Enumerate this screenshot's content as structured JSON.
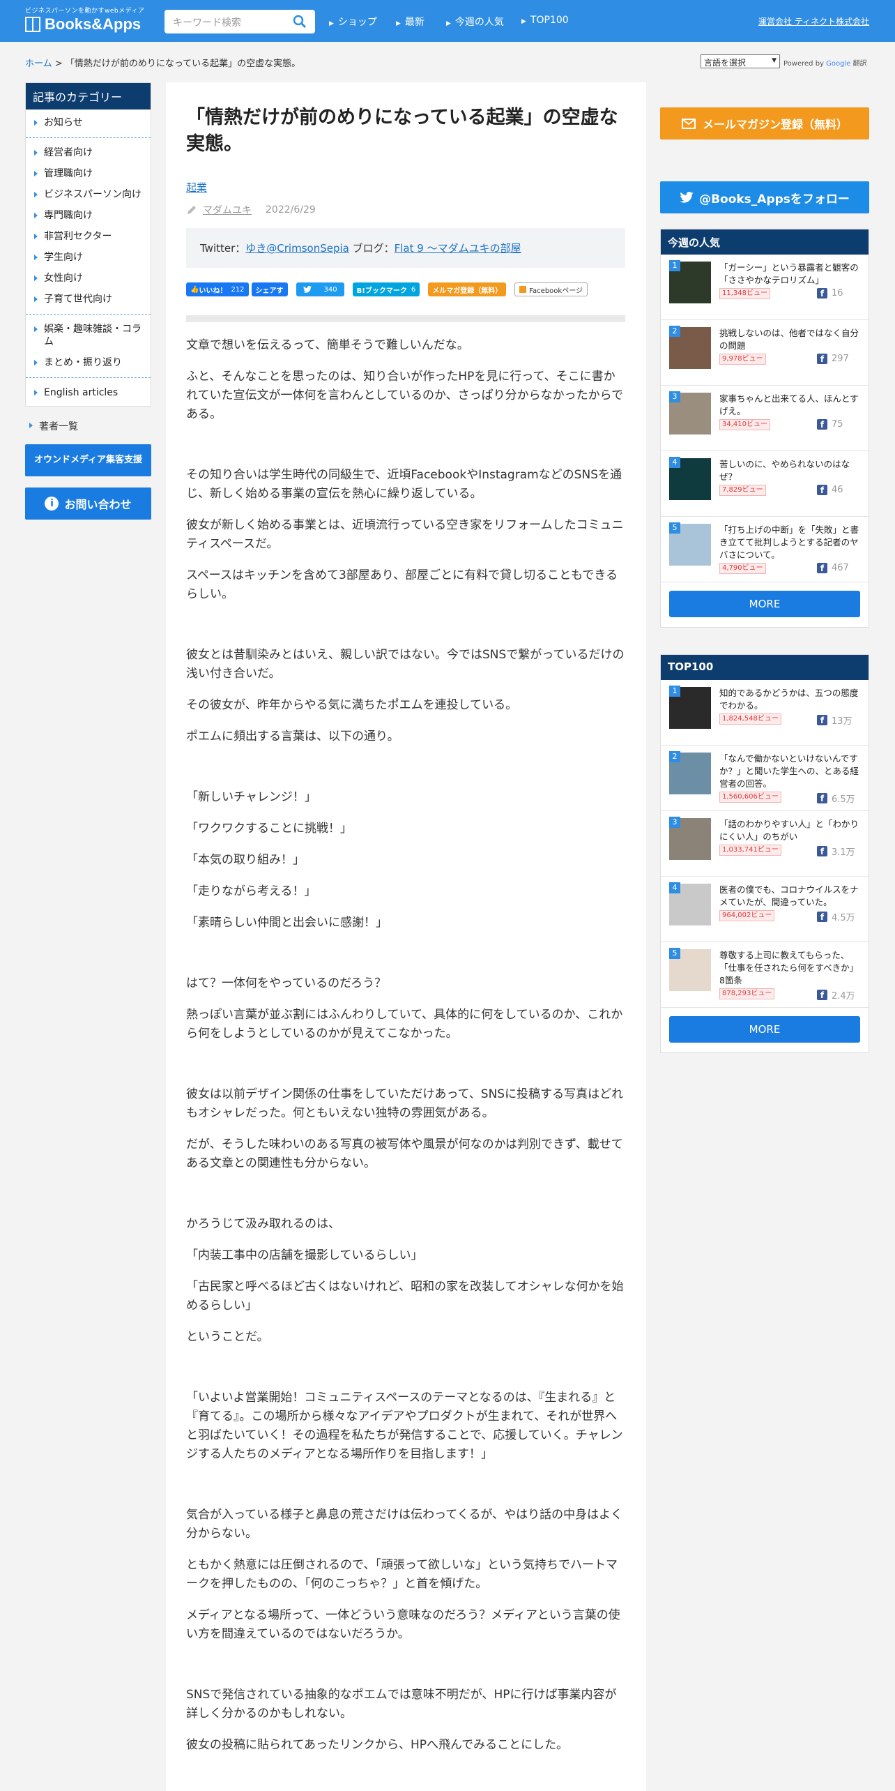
{
  "header": {
    "tagline": "ビジネスパーソンを動かすwebメディア",
    "logo": "Books&Apps",
    "search_placeholder": "キーワード検索",
    "nav": [
      "ショップ",
      "最新",
      "今週の人気",
      "TOP100"
    ],
    "company": "運営会社 ティネクト株式会社"
  },
  "breadcrumb": {
    "home": "ホーム",
    "sep": ">",
    "current": "「情熱だけが前のめりになっている起業」の空虚な実態。"
  },
  "translate": {
    "select": "言語を選択",
    "powered": "Powered by",
    "google": "Google",
    "label": "翻訳"
  },
  "left": {
    "cat_title": "記事のカテゴリー",
    "group1": [
      "お知らせ"
    ],
    "group2": [
      "経営者向け",
      "管理職向け",
      "ビジネスパーソン向け",
      "専門職向け",
      "非営利セクター",
      "学生向け",
      "女性向け",
      "子育て世代向け"
    ],
    "group3": [
      "娯楽・趣味雑談・コラム",
      "まとめ・振り返り"
    ],
    "group4": [
      "English articles"
    ],
    "authors": "著者一覧",
    "owned_media": "オウンドメディア集客支援",
    "contact": "お問い合わせ"
  },
  "article": {
    "title": "「情熱だけが前のめりになっている起業」の空虚な実態。",
    "category": "起業",
    "author": "マダムユキ",
    "date": "2022/6/29",
    "tw_prefix": "Twitter：",
    "tw_link": "ゆき@CrimsonSepia",
    "blog_prefix": " ブログ：",
    "blog_link": "Flat 9 〜マダムユキの部屋",
    "share": {
      "like": "いいね！",
      "like_count": "212",
      "share": "シェアす",
      "tweet_count": "340",
      "hatena": "B!ブックマーク",
      "hatena_count": "6",
      "mail": "メルマガ登録（無料）",
      "fbpage": "Facebookページ"
    },
    "p": [
      "文章で想いを伝えるって、簡単そうで難しいんだな。",
      "ふと、そんなことを思ったのは、知り合いが作ったHPを見に行って、そこに書かれていた宣伝文が一体何を言わんとしているのか、さっぱり分からなかったからである。",
      "その知り合いは学生時代の同級生で、近頃FacebookやInstagramなどのSNSを通じ、新しく始める事業の宣伝を熱心に繰り返している。",
      "彼女が新しく始める事業とは、近頃流行っている空き家をリフォームしたコミュニティスペースだ。",
      "スペースはキッチンを含めて3部屋あり、部屋ごとに有料で貸し切ることもできるらしい。",
      "彼女とは昔馴染みとはいえ、親しい訳ではない。今ではSNSで繋がっているだけの浅い付き合いだ。",
      "その彼女が、昨年からやる気に満ちたポエムを連投している。",
      "ポエムに頻出する言葉は、以下の通り。",
      "「新しいチャレンジ！」",
      "「ワクワクすることに挑戦！」",
      "「本気の取り組み！」",
      "「走りながら考える！」",
      "「素晴らしい仲間と出会いに感謝！」",
      "はて？一体何をやっているのだろう？",
      "熱っぽい言葉が並ぶ割にはふんわりしていて、具体的に何をしているのか、これから何をしようとしているのかが見えてこなかった。",
      "彼女は以前デザイン関係の仕事をしていただけあって、SNSに投稿する写真はどれもオシャレだった。何ともいえない独特の雰囲気がある。",
      "だが、そうした味わいのある写真の被写体や風景が何なのかは判別できず、載せてある文章との関連性も分からない。",
      "かろうじて汲み取れるのは、",
      "「内装工事中の店舗を撮影しているらしい」",
      "「古民家と呼べるほど古くはないけれど、昭和の家を改装してオシャレな何かを始めるらしい」",
      "ということだ。",
      "「いよいよ営業開始！コミュニティスペースのテーマとなるのは、『生まれる』と『育てる』。この場所から様々なアイデアやプロダクトが生まれて、それが世界へと羽ばたいていく！その過程を私たちが発信することで、応援していく。チャレンジする人たちのメディアとなる場所作りを目指します！」",
      "気合が入っている様子と鼻息の荒さだけは伝わってくるが、やはり話の中身はよく分からない。",
      "ともかく熱意には圧倒されるので、「頑張って欲しいな」という気持ちでハートマークを押したものの、「何のこっちゃ？」と首を傾げた。",
      "メディアとなる場所って、一体どういう意味なのだろう？メディアという言葉の使い方を間違えているのではないだろうか。",
      "SNSで発信されている抽象的なポエムでは意味不明だが、HPに行けば事業内容が詳しく分かるのかもしれない。",
      "彼女の投稿に貼られてあったリンクから、HPへ飛んでみることにした。"
    ]
  },
  "right": {
    "mail_btn": "メールマガジン登録（無料）",
    "tw_btn": "@Books_Appsをフォロー",
    "weekly_title": "今週の人気",
    "weekly": [
      {
        "n": "1",
        "title": "「ガーシー」という暴露者と観客の「ささやかなテロリズム」",
        "views": "11,348ビュー",
        "fb": "16"
      },
      {
        "n": "2",
        "title": "挑戦しないのは、他者ではなく自分の問題",
        "views": "9,978ビュー",
        "fb": "297"
      },
      {
        "n": "3",
        "title": "家事ちゃんと出来てる人、ほんとすげえ。",
        "views": "34,410ビュー",
        "fb": "75"
      },
      {
        "n": "4",
        "title": "苦しいのに、やめられないのはなぜ？",
        "views": "7,829ビュー",
        "fb": "46"
      },
      {
        "n": "5",
        "title": "「打ち上げの中断」を「失敗」と書き立てて批判しようとする記者のヤバさについて。",
        "views": "4,790ビュー",
        "fb": "467"
      }
    ],
    "top_title": "TOP100",
    "top": [
      {
        "n": "1",
        "title": "知的であるかどうかは、五つの態度でわかる。",
        "views": "1,824,548ビュー",
        "fb": "13万"
      },
      {
        "n": "2",
        "title": "「なんで働かないといけないんですか？」と聞いた学生への、とある経営者の回答。",
        "views": "1,560,606ビュー",
        "fb": "6.5万"
      },
      {
        "n": "3",
        "title": "「話のわかりやすい人」と「わかりにくい人」のちがい",
        "views": "1,033,741ビュー",
        "fb": "3.1万"
      },
      {
        "n": "4",
        "title": "医者の僕でも、コロナウイルスをナメていたが、間違っていた。",
        "views": "964,002ビュー",
        "fb": "4.5万"
      },
      {
        "n": "5",
        "title": "尊敬する上司に教えてもらった、「仕事を任されたら何をすべきか」8箇条",
        "views": "878,293ビュー",
        "fb": "2.4万"
      }
    ],
    "more": "MORE"
  },
  "colors": {
    "header": "#2f8ee4",
    "navy": "#0d3c6e",
    "orange": "#f39a1e",
    "blue": "#1a7ce0"
  }
}
